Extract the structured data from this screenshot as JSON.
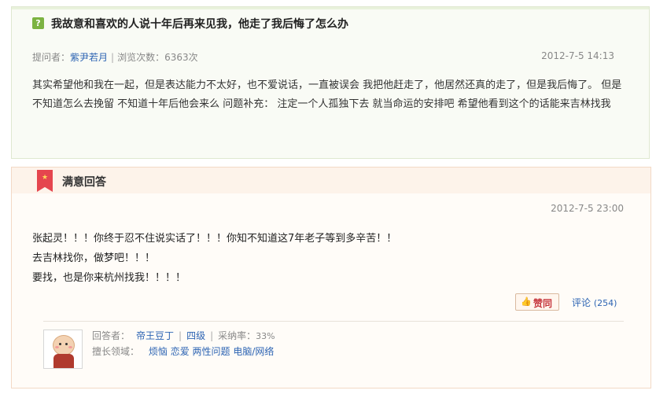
{
  "question": {
    "icon_label": "?",
    "title": "我故意和喜欢的人说十年后再来见我，他走了我后悔了怎么办",
    "asker_label": "提问者：",
    "asker_name": "紫尹若月",
    "views_text": "浏览次数：6363次",
    "date": "2012-7-5 14:13",
    "body": "其实希望他和我在一起，但是表达能力不太好，也不爱说话，一直被误会 我把他赶走了，他居然还真的走了，但是我后悔了。 但是不知道怎么去挽留 不知道十年后他会来么 问题补充： 注定一个人孤独下去 就当命运的安排吧 希望他看到这个的话能来吉林找我"
  },
  "answer": {
    "section_title": "满意回答",
    "date": "2012-7-5 23:00",
    "lines": [
      "张起灵！！！你终于忍不住说实话了！！！你知不知道这7年老子等到多辛苦！！",
      "去吉林找你，做梦吧！！！",
      "要找，也是你来杭州找我！！！！"
    ],
    "like_label": "赞同",
    "comment_label": "评论",
    "comment_count": "(254)",
    "answerer_label": "回答者：",
    "answerer_name": "帝王豆丁",
    "level": "四级",
    "adopt_rate_label": "采纳率：",
    "adopt_rate": "33%",
    "expertise_label": "擅长领域：",
    "expertise": [
      "烦恼",
      "恋爱",
      "两性问题",
      "电脑/网络"
    ]
  },
  "colors": {
    "link": "#2d64b3",
    "medal": "#e5454e",
    "question_bg": "#f9fbf5",
    "answer_bg": "#fffcf8"
  },
  "icons": {
    "question": "question-mark-icon",
    "best_answer": "medal-icon",
    "like": "thumbs-up-icon",
    "avatar": "cartoon-avatar"
  }
}
